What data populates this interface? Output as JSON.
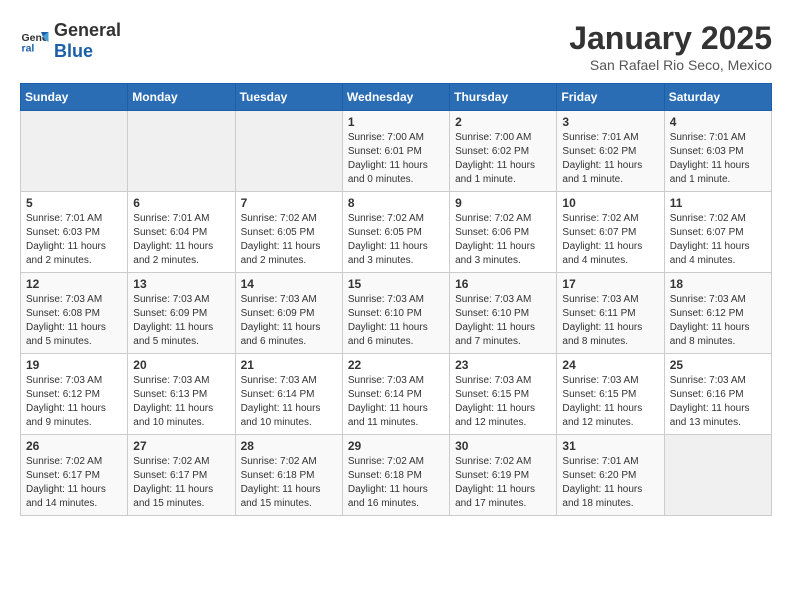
{
  "logo": {
    "general": "General",
    "blue": "Blue"
  },
  "title": "January 2025",
  "location": "San Rafael Rio Seco, Mexico",
  "days_of_week": [
    "Sunday",
    "Monday",
    "Tuesday",
    "Wednesday",
    "Thursday",
    "Friday",
    "Saturday"
  ],
  "weeks": [
    [
      {
        "day": "",
        "sunrise": "",
        "sunset": "",
        "daylight": "",
        "empty": true
      },
      {
        "day": "",
        "sunrise": "",
        "sunset": "",
        "daylight": "",
        "empty": true
      },
      {
        "day": "",
        "sunrise": "",
        "sunset": "",
        "daylight": "",
        "empty": true
      },
      {
        "day": "1",
        "sunrise": "Sunrise: 7:00 AM",
        "sunset": "Sunset: 6:01 PM",
        "daylight": "Daylight: 11 hours and 0 minutes."
      },
      {
        "day": "2",
        "sunrise": "Sunrise: 7:00 AM",
        "sunset": "Sunset: 6:02 PM",
        "daylight": "Daylight: 11 hours and 1 minute."
      },
      {
        "day": "3",
        "sunrise": "Sunrise: 7:01 AM",
        "sunset": "Sunset: 6:02 PM",
        "daylight": "Daylight: 11 hours and 1 minute."
      },
      {
        "day": "4",
        "sunrise": "Sunrise: 7:01 AM",
        "sunset": "Sunset: 6:03 PM",
        "daylight": "Daylight: 11 hours and 1 minute."
      }
    ],
    [
      {
        "day": "5",
        "sunrise": "Sunrise: 7:01 AM",
        "sunset": "Sunset: 6:03 PM",
        "daylight": "Daylight: 11 hours and 2 minutes."
      },
      {
        "day": "6",
        "sunrise": "Sunrise: 7:01 AM",
        "sunset": "Sunset: 6:04 PM",
        "daylight": "Daylight: 11 hours and 2 minutes."
      },
      {
        "day": "7",
        "sunrise": "Sunrise: 7:02 AM",
        "sunset": "Sunset: 6:05 PM",
        "daylight": "Daylight: 11 hours and 2 minutes."
      },
      {
        "day": "8",
        "sunrise": "Sunrise: 7:02 AM",
        "sunset": "Sunset: 6:05 PM",
        "daylight": "Daylight: 11 hours and 3 minutes."
      },
      {
        "day": "9",
        "sunrise": "Sunrise: 7:02 AM",
        "sunset": "Sunset: 6:06 PM",
        "daylight": "Daylight: 11 hours and 3 minutes."
      },
      {
        "day": "10",
        "sunrise": "Sunrise: 7:02 AM",
        "sunset": "Sunset: 6:07 PM",
        "daylight": "Daylight: 11 hours and 4 minutes."
      },
      {
        "day": "11",
        "sunrise": "Sunrise: 7:02 AM",
        "sunset": "Sunset: 6:07 PM",
        "daylight": "Daylight: 11 hours and 4 minutes."
      }
    ],
    [
      {
        "day": "12",
        "sunrise": "Sunrise: 7:03 AM",
        "sunset": "Sunset: 6:08 PM",
        "daylight": "Daylight: 11 hours and 5 minutes."
      },
      {
        "day": "13",
        "sunrise": "Sunrise: 7:03 AM",
        "sunset": "Sunset: 6:09 PM",
        "daylight": "Daylight: 11 hours and 5 minutes."
      },
      {
        "day": "14",
        "sunrise": "Sunrise: 7:03 AM",
        "sunset": "Sunset: 6:09 PM",
        "daylight": "Daylight: 11 hours and 6 minutes."
      },
      {
        "day": "15",
        "sunrise": "Sunrise: 7:03 AM",
        "sunset": "Sunset: 6:10 PM",
        "daylight": "Daylight: 11 hours and 6 minutes."
      },
      {
        "day": "16",
        "sunrise": "Sunrise: 7:03 AM",
        "sunset": "Sunset: 6:10 PM",
        "daylight": "Daylight: 11 hours and 7 minutes."
      },
      {
        "day": "17",
        "sunrise": "Sunrise: 7:03 AM",
        "sunset": "Sunset: 6:11 PM",
        "daylight": "Daylight: 11 hours and 8 minutes."
      },
      {
        "day": "18",
        "sunrise": "Sunrise: 7:03 AM",
        "sunset": "Sunset: 6:12 PM",
        "daylight": "Daylight: 11 hours and 8 minutes."
      }
    ],
    [
      {
        "day": "19",
        "sunrise": "Sunrise: 7:03 AM",
        "sunset": "Sunset: 6:12 PM",
        "daylight": "Daylight: 11 hours and 9 minutes."
      },
      {
        "day": "20",
        "sunrise": "Sunrise: 7:03 AM",
        "sunset": "Sunset: 6:13 PM",
        "daylight": "Daylight: 11 hours and 10 minutes."
      },
      {
        "day": "21",
        "sunrise": "Sunrise: 7:03 AM",
        "sunset": "Sunset: 6:14 PM",
        "daylight": "Daylight: 11 hours and 10 minutes."
      },
      {
        "day": "22",
        "sunrise": "Sunrise: 7:03 AM",
        "sunset": "Sunset: 6:14 PM",
        "daylight": "Daylight: 11 hours and 11 minutes."
      },
      {
        "day": "23",
        "sunrise": "Sunrise: 7:03 AM",
        "sunset": "Sunset: 6:15 PM",
        "daylight": "Daylight: 11 hours and 12 minutes."
      },
      {
        "day": "24",
        "sunrise": "Sunrise: 7:03 AM",
        "sunset": "Sunset: 6:15 PM",
        "daylight": "Daylight: 11 hours and 12 minutes."
      },
      {
        "day": "25",
        "sunrise": "Sunrise: 7:03 AM",
        "sunset": "Sunset: 6:16 PM",
        "daylight": "Daylight: 11 hours and 13 minutes."
      }
    ],
    [
      {
        "day": "26",
        "sunrise": "Sunrise: 7:02 AM",
        "sunset": "Sunset: 6:17 PM",
        "daylight": "Daylight: 11 hours and 14 minutes."
      },
      {
        "day": "27",
        "sunrise": "Sunrise: 7:02 AM",
        "sunset": "Sunset: 6:17 PM",
        "daylight": "Daylight: 11 hours and 15 minutes."
      },
      {
        "day": "28",
        "sunrise": "Sunrise: 7:02 AM",
        "sunset": "Sunset: 6:18 PM",
        "daylight": "Daylight: 11 hours and 15 minutes."
      },
      {
        "day": "29",
        "sunrise": "Sunrise: 7:02 AM",
        "sunset": "Sunset: 6:18 PM",
        "daylight": "Daylight: 11 hours and 16 minutes."
      },
      {
        "day": "30",
        "sunrise": "Sunrise: 7:02 AM",
        "sunset": "Sunset: 6:19 PM",
        "daylight": "Daylight: 11 hours and 17 minutes."
      },
      {
        "day": "31",
        "sunrise": "Sunrise: 7:01 AM",
        "sunset": "Sunset: 6:20 PM",
        "daylight": "Daylight: 11 hours and 18 minutes."
      },
      {
        "day": "",
        "sunrise": "",
        "sunset": "",
        "daylight": "",
        "empty": true
      }
    ]
  ]
}
